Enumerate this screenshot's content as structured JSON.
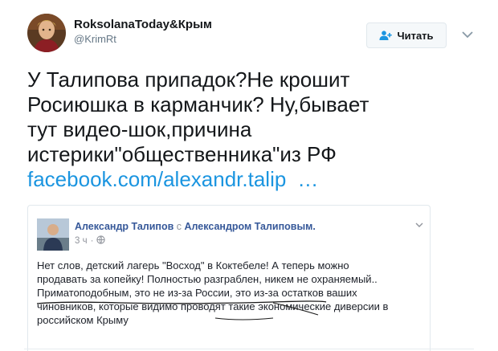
{
  "tweet": {
    "author_name": "RoksolanaToday&Крым",
    "author_handle": "@KrimRt",
    "follow_label": "Читать",
    "text_lines": [
      "У Талипова припадок?Не крошит",
      "Росиюшка в карманчик? Ну,бывает",
      "тут видео-шок,причина",
      "истерики\"общественника\"из РФ"
    ],
    "link_text": "facebook.com/alexandr.talip",
    "link_ellipsis": "…"
  },
  "embed": {
    "poster_name": "Александр Талипов",
    "with_text": "с",
    "tagged_name": "Александром Талиповым.",
    "time": "3 ч",
    "dot": "·",
    "body_lines": [
      "Нет слов, детский лагерь \"Восход\" в Коктебеле! А теперь можно",
      "продавать за копейку! Полностью разграблен, никем не охраняемый..",
      "Приматоподобным, это не из-за России, это из-за остатков ваших",
      "чиновников, которые видимо проводят такие экономические диверсии в",
      "российском Крыму"
    ]
  },
  "colors": {
    "link": "#1b95e0",
    "fb_name": "#365899",
    "muted": "#657786"
  },
  "icons": [
    "user-plus-icon",
    "chevron-down-icon",
    "globe-icon",
    "fb-chevron-icon"
  ]
}
